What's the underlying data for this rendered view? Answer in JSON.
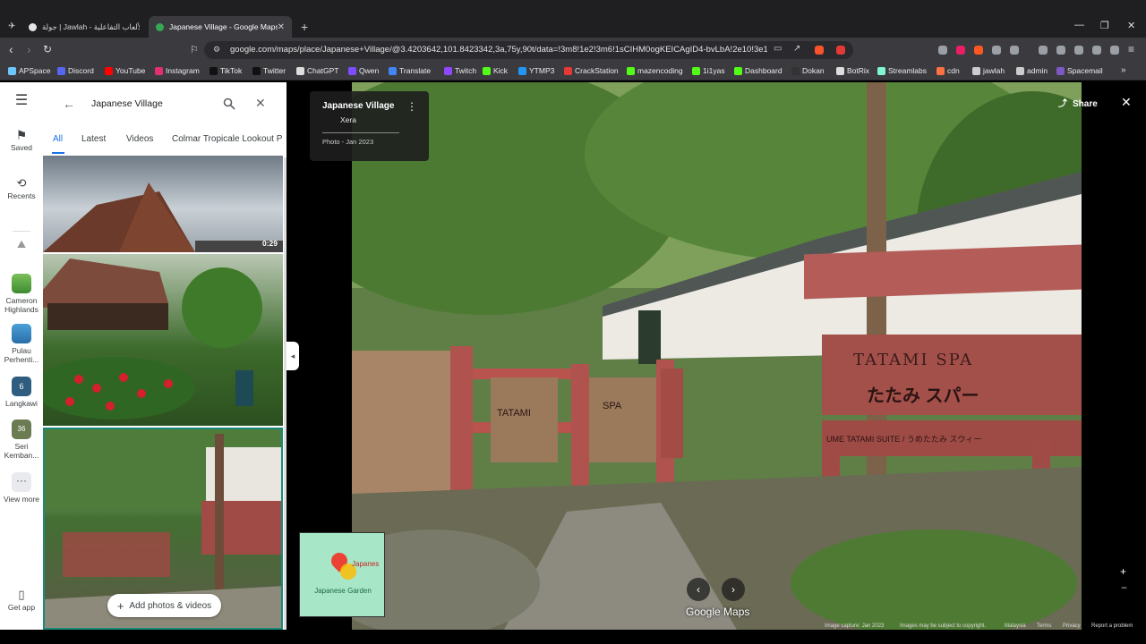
{
  "browser": {
    "inactive_tab": "جولة | Jawlah - منصة الألعاب التفاعلية",
    "active_tab": "Japanese Village - Google Maps",
    "url": "google.com/maps/place/Japanese+Village/@3.4203642,101.8423342,3a,75y,90t/data=!3m8!1e2!3m6!1sCIHM0ogKEICAgID4-bvLbA!2e10!3e12!..."
  },
  "bookmarks": [
    {
      "label": "APSpace",
      "color": "#6ec6ff"
    },
    {
      "label": "Discord",
      "color": "#5865f2"
    },
    {
      "label": "YouTube",
      "color": "#ff0000"
    },
    {
      "label": "Instagram",
      "color": "#e1306c"
    },
    {
      "label": "TikTok",
      "color": "#111111"
    },
    {
      "label": "Twitter",
      "color": "#111111"
    },
    {
      "label": "ChatGPT",
      "color": "#dddddd"
    },
    {
      "label": "Qwen",
      "color": "#7c4dff"
    },
    {
      "label": "Translate",
      "color": "#4285f4"
    },
    {
      "label": "Twitch",
      "color": "#9146ff"
    },
    {
      "label": "Kick",
      "color": "#53fc18"
    },
    {
      "label": "YTMP3",
      "color": "#2196f3"
    },
    {
      "label": "CrackStation",
      "color": "#e53935"
    },
    {
      "label": "mazencoding",
      "color": "#53fc18"
    },
    {
      "label": "1i1yas",
      "color": "#53fc18"
    },
    {
      "label": "Dashboard",
      "color": "#53fc18"
    },
    {
      "label": "Dokan",
      "color": "#333333"
    },
    {
      "label": "BotRix",
      "color": "#dddddd"
    },
    {
      "label": "Streamlabs",
      "color": "#80f5d2"
    },
    {
      "label": "cdn",
      "color": "#ff7043"
    },
    {
      "label": "jawlah",
      "color": "#cccccc"
    },
    {
      "label": "admin",
      "color": "#cccccc"
    },
    {
      "label": "Spacemail",
      "color": "#7e57c2"
    }
  ],
  "rail": {
    "saved": "Saved",
    "recents": "Recents",
    "cameron": "Cameron Highlands",
    "pulau": "Pulau Perhenti...",
    "langkawi": "Langkawi",
    "langkawi_count": "6",
    "seri": "Seri Kemban...",
    "seri_count": "36",
    "view_more": "View more",
    "get_app": "Get app"
  },
  "search": {
    "query": "Japanese Village"
  },
  "chips": [
    "All",
    "Latest",
    "Videos",
    "Colmar Tropicale Lookout P"
  ],
  "photos": {
    "duration": "0:29",
    "add_button": "Add photos & videos"
  },
  "viewer": {
    "place": "Japanese Village",
    "author": "Xera",
    "date": "Photo - Jan 2023",
    "share": "Share",
    "minimap_label": "Japanese Garden",
    "minimap_pin": "Japanes",
    "watermark": "Google Maps",
    "sign_main": "TATAMI SPA",
    "sign_jp": "たたみ スパー",
    "sign_sub": "UME TATAMI SUITE / うめたたみ スウィー",
    "gate_left": "TATAMI",
    "gate_right": "SPA",
    "footer": {
      "capture": "Image capture: Jan 2023",
      "rights": "Images may be subject to copyright.",
      "country": "Malaysia",
      "terms": "Terms",
      "privacy": "Privacy",
      "report": "Report a problem"
    }
  }
}
